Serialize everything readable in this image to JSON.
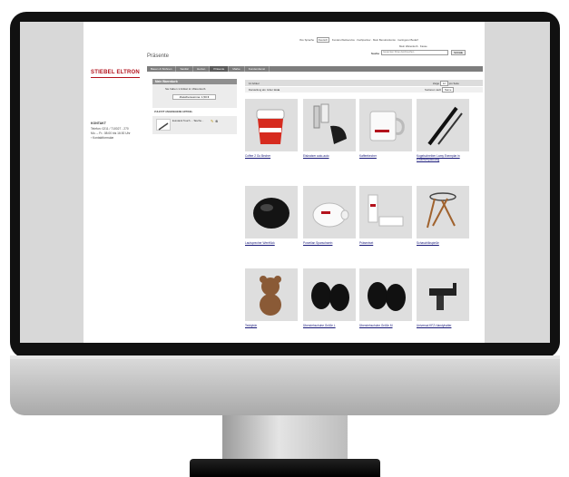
{
  "header": {
    "lang_label": "Ihre Sprache",
    "lang_value": "Deutsch",
    "top_links": "Kunden-Webservice · Fachpartner · Mein Benutzerkonto · Geringerer Bedarf",
    "top_links2": "Mein Warenkorb · Kasse",
    "search_label": "Suche",
    "search_placeholder": "Gesamten Shop durchsuchen",
    "search_button": "SUCHE"
  },
  "brand": {
    "logo_text": "STIEBEL ELTRON"
  },
  "page_title": "Präsente",
  "nav": [
    "Bauen & Wohnen",
    "Sanitär",
    "Heizen",
    "Präsente",
    "Marke",
    "Kundendienst"
  ],
  "sidebar": {
    "cart_title": "Mein Warenkorb",
    "cart_line1": "Sie haben 1 Artikel im Warenkorb",
    "cart_button": "Zwischensumme: 1,50 €",
    "recent_title": "ZULETZT ANGESEHENE ARTIKEL",
    "recent_item": "Eurotank Touch ... Tasche..."
  },
  "contact": {
    "title": "KONTAKT",
    "lines": [
      "Telefon: 0211 / 710027 - 270",
      "Mo. – Fr.: 08:00 bis 16:00 Uhr",
      "› Kontaktformular"
    ]
  },
  "listing": {
    "count": "12 Artikel",
    "show_label": "Zeige",
    "show_value": "12",
    "per_page": "pro Seite",
    "view_label": "Darstellung als: Gitter",
    "view_value": "Liste",
    "sort_label": "Sortieren nach",
    "sort_value": "Name"
  },
  "products": [
    {
      "name": "Coffee 2 Go Becher",
      "icon": "coffee-cup-icon"
    },
    {
      "name": "Eiskratzer auto-auto",
      "icon": "ice-scraper-icon"
    },
    {
      "name": "Kaffeebecher",
      "icon": "mug-icon"
    },
    {
      "name": "Kugelschreiber Lamy Exemplar in Einzelverpackung",
      "icon": "pen-icon"
    },
    {
      "name": "Lautsprecher WeelKick",
      "icon": "speaker-icon"
    },
    {
      "name": "Porzellan Sparschwein",
      "icon": "piggy-bank-icon"
    },
    {
      "name": "Präsentset",
      "icon": "gift-set-icon"
    },
    {
      "name": "Schaschlikspieße",
      "icon": "skewers-icon"
    },
    {
      "name": "Teddybär",
      "icon": "teddy-icon"
    },
    {
      "name": "Überziehschuhe Größe L",
      "icon": "slippers-icon"
    },
    {
      "name": "Überziehschuhe Größe M",
      "icon": "slippers-icon"
    },
    {
      "name": "Universal KFZ-Handyhalter",
      "icon": "phone-holder-icon"
    }
  ],
  "colors": {
    "brand_red": "#b3121c",
    "nav_bg": "#7d7d7d",
    "bezel": "#111111"
  }
}
